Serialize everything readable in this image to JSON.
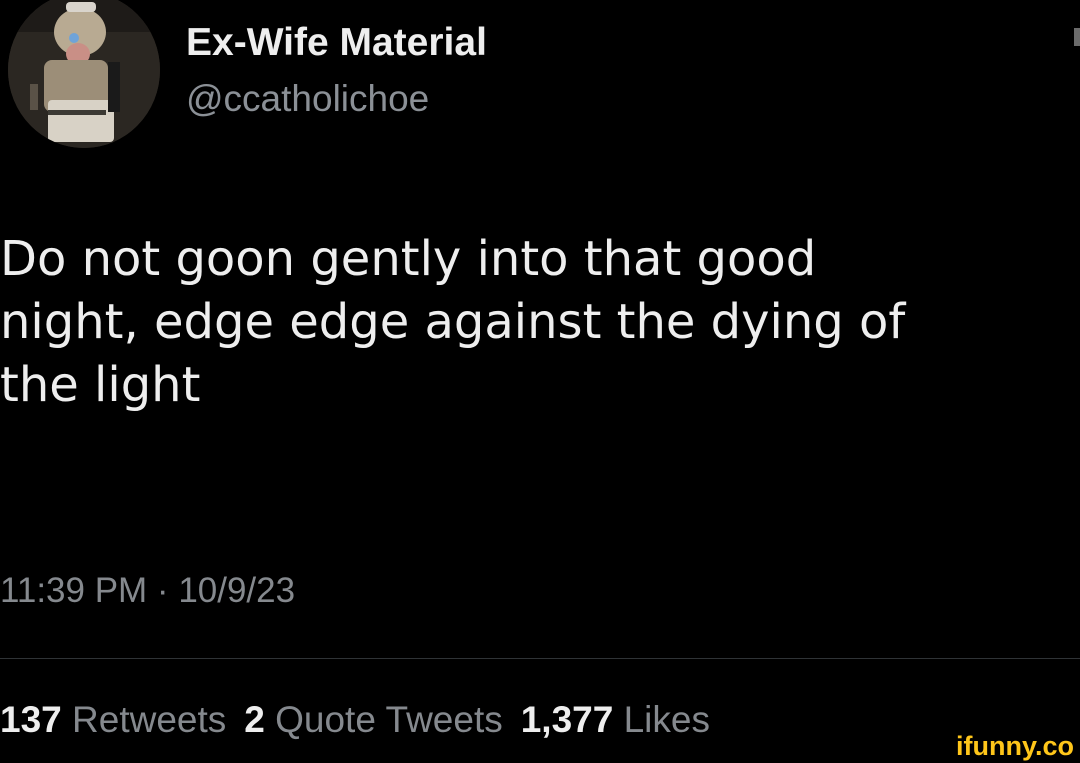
{
  "tweet": {
    "display_name": "Ex-Wife Material",
    "handle": "@ccatholichoe",
    "avatar_icon": "profile-photo",
    "text_lines": [
      "Do not goon gently into that good",
      "night, edge edge against the dying of",
      "the light"
    ],
    "timestamp": "11:39 PM · 10/9/23",
    "stats": {
      "retweets_count": "137",
      "retweets_label": "Retweets",
      "quotes_count": "2",
      "quotes_label": "Quote Tweets",
      "likes_count": "1,377",
      "likes_label": "Likes"
    }
  },
  "watermark": "ifunny.co",
  "colors": {
    "background": "#000000",
    "primary_text": "#eeeeee",
    "secondary_text": "#85898e",
    "watermark": "#ffc61a"
  }
}
